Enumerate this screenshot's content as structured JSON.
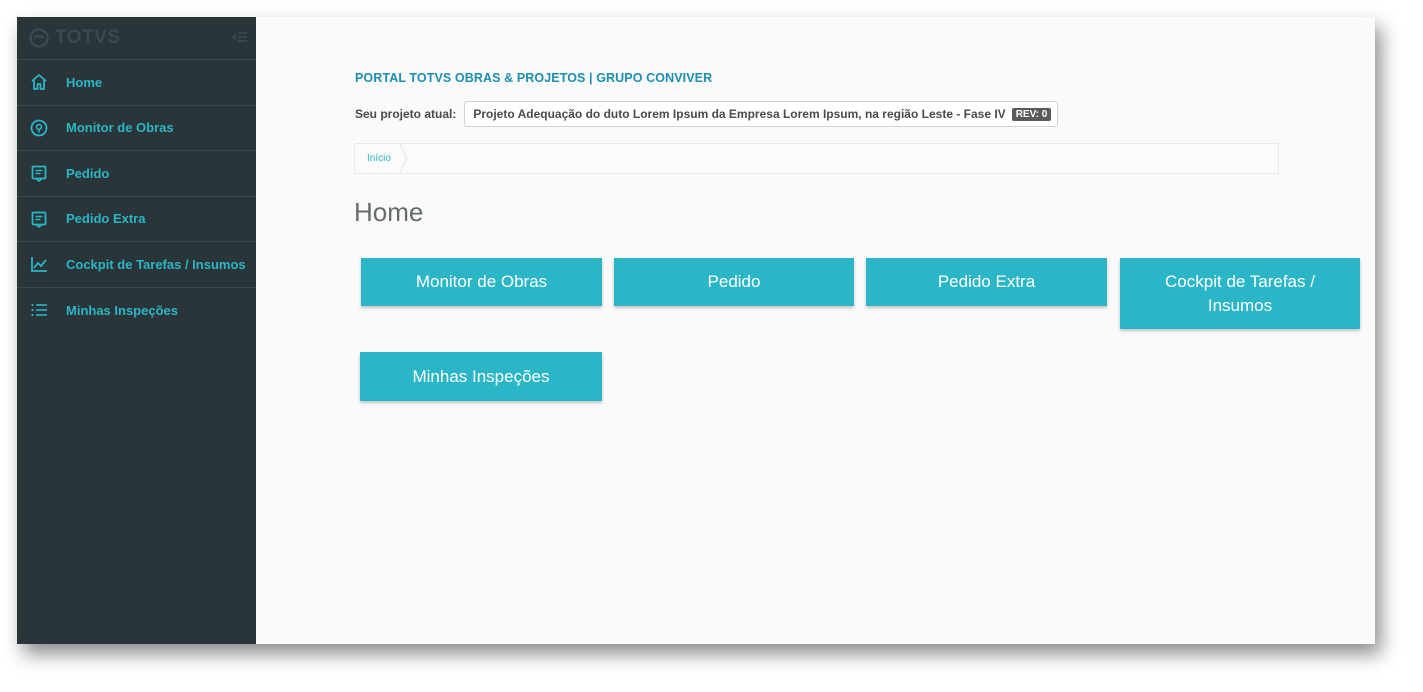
{
  "brand": {
    "name": "TOTVS",
    "logo_icon": "totvs-logo-icon",
    "collapse_icon": "collapse-menu-icon"
  },
  "sidebar": {
    "items": [
      {
        "label": "Home",
        "icon": "home-icon"
      },
      {
        "label": "Monitor de Obras",
        "icon": "location-pin-icon"
      },
      {
        "label": "Pedido",
        "icon": "receipt-icon"
      },
      {
        "label": "Pedido Extra",
        "icon": "receipt-icon"
      },
      {
        "label": "Cockpit de Tarefas / Insumos",
        "icon": "chart-icon"
      },
      {
        "label": "Minhas Inspeções",
        "icon": "list-icon"
      }
    ]
  },
  "header": {
    "portal_title": "PORTAL TOTVS OBRAS & PROJETOS | GRUPO CONVIVER",
    "project_label": "Seu projeto atual:",
    "project_name": "Projeto Adequação do duto Lorem Ipsum da Empresa Lorem Ipsum, na região Leste - Fase IV",
    "rev_badge": "REV: 0"
  },
  "breadcrumb": {
    "items": [
      "Início"
    ]
  },
  "main": {
    "heading": "Home",
    "tiles": [
      {
        "label": "Monitor de Obras"
      },
      {
        "label": "Pedido"
      },
      {
        "label": "Pedido Extra"
      },
      {
        "label": "Cockpit de Tarefas / Insumos"
      },
      {
        "label": "Minhas Inspeções"
      }
    ]
  },
  "colors": {
    "sidebar_bg": "#293538",
    "accent": "#2bb6c7",
    "title_blue": "#1b8fb0",
    "page_bg": "#fafafa"
  }
}
